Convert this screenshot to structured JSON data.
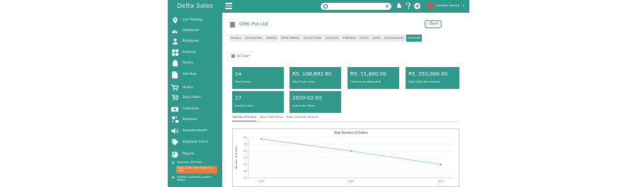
{
  "app": {
    "brand": "Delta Sales"
  },
  "sidebar": {
    "items": [
      {
        "label": "Live Tracking",
        "icon": "location-pin-icon"
      },
      {
        "label": "Dashboard",
        "icon": "dashboard-icon"
      },
      {
        "label": "Employees",
        "icon": "person-icon"
      },
      {
        "label": "Products",
        "icon": "grid-icon"
      },
      {
        "label": "Parties",
        "icon": "building-icon"
      },
      {
        "label": "Activities",
        "icon": "document-icon"
      },
      {
        "label": "Orders",
        "icon": "cart-icon"
      },
      {
        "label": "Zero Orders",
        "icon": "cart-x-icon"
      },
      {
        "label": "Collections",
        "icon": "money-icon"
      },
      {
        "label": "Expenses",
        "icon": "expenses-icon"
      },
      {
        "label": "Announcements",
        "icon": "megaphone-icon"
      },
      {
        "label": "Employee Leave",
        "icon": "tag-icon"
      },
      {
        "label": "Reports",
        "icon": "pie-chart-icon"
      }
    ],
    "report_subitems": [
      {
        "label": "Salesman GPS Path",
        "active": false
      },
      {
        "label": "Daily Sales Order Report (by unit)",
        "active": true
      },
      {
        "label": "Checkin-Checkout Location Report",
        "active": false
      }
    ]
  },
  "topbar": {
    "search_placeholder": "",
    "clear_glyph": "×",
    "notification_badge": "",
    "user_name": "Pradhika Kalwara"
  },
  "page": {
    "company_name": "DMO Pvt Ltd",
    "back_label": "Back",
    "tabs": [
      "DETAILS",
      "ACCOUNTING",
      "ORDERS",
      "ZERO ORDERS",
      "COLLECTIONS",
      "ACTIVITIES",
      "EXPENSES",
      "NOTES",
      "VISITS",
      "ACCESSIBLE BY",
      "SUMMARY"
    ],
    "active_tab": "SUMMARY",
    "filter_label": "All Time*"
  },
  "summary_cards": [
    {
      "value": "14",
      "caption": "Total Orders"
    },
    {
      "value": "RS. 108,692.60",
      "caption": "Total Order Value"
    },
    {
      "value": "RS. 11,800.00",
      "caption": "Check to be Deposited"
    },
    {
      "value": "RS. 252,000.00",
      "caption": "Total Collection Amount"
    },
    {
      "value": "17",
      "caption": "Products Sold"
    },
    {
      "value": "2020-02-02",
      "caption": "Last Order Taken"
    }
  ],
  "chart_tabs": [
    "Total No of Orders",
    "Total Order Value",
    "Total Collection Amount"
  ],
  "active_chart_tab": "Total No of Orders",
  "colors": {
    "accent": "#2f9a8b",
    "active_sub": "#f07a3a",
    "line": "#8fd3c8"
  },
  "chart_data": {
    "type": "line",
    "title": "Total Number of Orders",
    "ylabel": "Number of Orders",
    "xlabel": "",
    "categories": [
      "2019",
      "2020",
      "2021"
    ],
    "values": [
      2.9,
      2.0,
      1.0
    ],
    "yticks": [
      "3.0",
      "2.5",
      "2.0",
      "1.5",
      "1.0",
      "0.5",
      "0.0"
    ],
    "ylim": [
      0,
      3
    ],
    "grid": true
  }
}
